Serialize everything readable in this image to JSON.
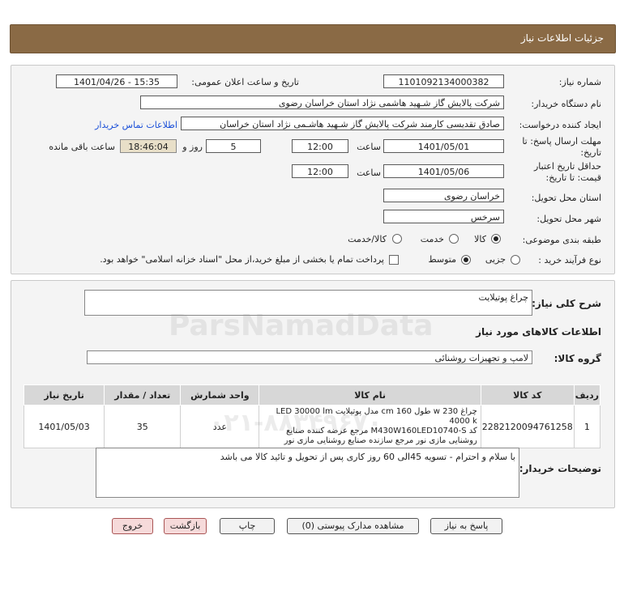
{
  "header": {
    "title": "جزئیات اطلاعات نیاز"
  },
  "form": {
    "need_number_label": "شماره نیاز:",
    "need_number": "1101092134000382",
    "announce_label": "تاریخ و ساعت اعلان عمومی:",
    "announce_value": "1401/04/26 - 15:35",
    "buyer_label": "نام دستگاه خریدار:",
    "buyer_value": "شرکت پالایش گاز شـهید هاشمی نژاد   استان خراسان رضوی",
    "creator_label": "ایجاد کننده درخواست:",
    "creator_value": "صادق تقدیسی کارمند شرکت پالایش گاز شـهید هاشـمی نژاد   استان خراسان",
    "contact_link": "اطلاعات تماس خریدار",
    "deadline_label_1": "مهلت ارسال پاسخ: تا",
    "deadline_label_2": "تاریخ:",
    "deadline_date": "1401/05/01",
    "time_label": "ساعت",
    "deadline_time": "12:00",
    "days_value": "5",
    "days_label": "روز و",
    "remaining_time": "18:46:04",
    "remaining_label": "ساعت باقی مانده",
    "validity_label_1": "حداقل تاریخ اعتبار",
    "validity_label_2": "قیمت: تا تاریخ:",
    "validity_date": "1401/05/06",
    "validity_time": "12:00",
    "province_label": "استان محل تحویل:",
    "province_value": "خراسان رضوی",
    "city_label": "شهر محل تحویل:",
    "city_value": "سرخس",
    "category_label": "طبقه بندی موضوعی:",
    "category_options": [
      "کالا",
      "خدمت",
      "کالا/خدمت"
    ],
    "category_selected": "کالا",
    "process_label": "نوع فرآیند خرید :",
    "process_options": [
      "جزیی",
      "متوسط"
    ],
    "process_selected": "متوسط",
    "payment_note": "پرداخت تمام یا بخشی از مبلغ خرید،از محل \"اسناد خزانه اسلامی\" خواهد بود."
  },
  "summary": {
    "general_desc_label": "شرح کلی نیاز:",
    "general_desc_value": "چراغ پوتیلایت",
    "goods_info_title": "اطلاعات کالاهای مورد نیاز",
    "goods_group_label": "گروه کالا:",
    "goods_group_value": "لامپ و تجهیزات روشنائی"
  },
  "table": {
    "headers": [
      "ردیف",
      "کد کالا",
      "نام کالا",
      "واحد شمارش",
      "تعداد / مقدار",
      "تاریخ نیاز"
    ],
    "rows": [
      {
        "row": "1",
        "code": "2282120094761258",
        "name_line1": "چراغ w 230 طول cm 160 مدل پوتیلایت LED 30000 lm 4000 k",
        "name_line2": "کد M430W160LED10740-S مرجع عرضه کننده صنایع",
        "name_line3": "روشنایی مازی نور مرجع سازنده صنایع روشنایی مازی نور",
        "unit": "عدد",
        "qty": "35",
        "date": "1401/05/03"
      }
    ]
  },
  "buyer_notes": {
    "label": "توضیحات خریدار:",
    "value": "با سلام و احترام - تسویه 45الی 60 روز کاری پس از تحویل و تائید کالا می باشد"
  },
  "buttons": {
    "reply": "پاسخ به نیاز",
    "attachments": "مشاهده مدارک پیوستی (0)",
    "print": "چاپ",
    "back": "بازگشت",
    "exit": "خروج"
  },
  "watermark": {
    "brand": "ParsNamadData",
    "phone": "۰۲۱-۸۸۳۴۹۶۷۰"
  },
  "colors": {
    "header": "#8a6a45",
    "panel": "#f4f4f4",
    "link": "#1a4fd8"
  }
}
